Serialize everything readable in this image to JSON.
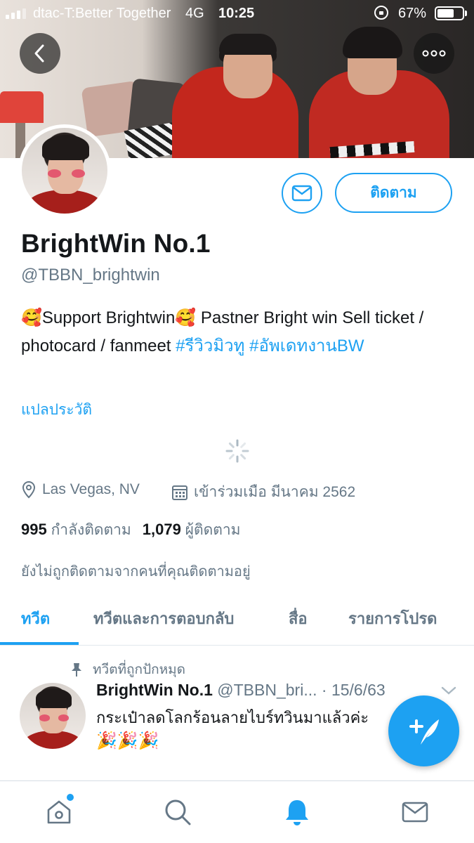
{
  "status_bar": {
    "carrier": "dtac-T:Better Together",
    "network": "4G",
    "time": "10:25",
    "battery_pct": "67%",
    "battery_level": 0.67
  },
  "profile": {
    "name": "BrightWin No.1",
    "handle": "@TBBN_brightwin",
    "bio_text": "🥰Support Brightwin🥰 Pastner Bright win Sell ticket / photocard / fanmeet ",
    "bio_hashtag_1": "#รีวิวมิวทู",
    "bio_space": " ",
    "bio_hashtag_2": "#อัพเดทงานBW",
    "translate_bio": "แปลประวัติ",
    "location": "Las Vegas, NV",
    "joined": "เข้าร่วมเมือ มีนาคม 2562",
    "following_count": "995",
    "following_label": "กำลังติดตาม",
    "followers_count": "1,079",
    "followers_label": "ผู้ติดตาม",
    "not_followed_note": "ยังไม่ถูกติดตามจากคนที่คุณติดตามอยู่"
  },
  "actions": {
    "follow_label": "ติดตาม"
  },
  "tabs": [
    {
      "label": "ทวีต",
      "active": true
    },
    {
      "label": "ทวีตและการตอบกลับ",
      "active": false
    },
    {
      "label": "สื่อ",
      "active": false
    },
    {
      "label": "รายการโปรด",
      "active": false
    }
  ],
  "pinned_tweet": {
    "pinned_label": "ทวีตที่ถูกปักหมุด",
    "author_name": "BrightWin No.1",
    "author_handle": "@TBBN_bri...",
    "date": " · 15/6/63",
    "text": "กระเป๋าลดโลกร้อนลายไบร์ทวินมาแล้วค่ะ",
    "emojis": "🎉🎉🎉"
  },
  "icons": {
    "back": "chevron-left-icon",
    "more": "more-horizontal-icon",
    "message": "envelope-icon",
    "location": "location-pin-icon",
    "calendar": "calendar-icon",
    "pin": "pin-icon",
    "compose": "compose-feather-icon",
    "home": "home-icon",
    "search": "search-icon",
    "notifications": "bell-icon",
    "messages": "envelope-icon"
  },
  "colors": {
    "accent": "#1da1f2",
    "secondary_text": "#657786",
    "primary_text": "#14171a"
  }
}
